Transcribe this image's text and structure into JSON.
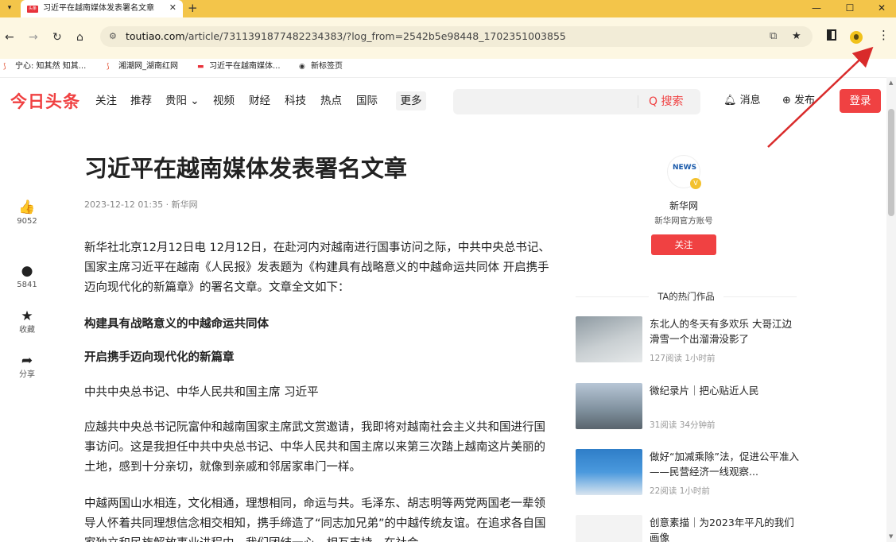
{
  "browser": {
    "tab_title": "习近平在越南媒体发表署名文章",
    "tab_favicon_text": "头条",
    "new_tab": "+",
    "minimize": "—",
    "maximize": "☐",
    "close": "✕",
    "tab_close": "✕",
    "url_host": "toutiao.com",
    "url_path": "/article/7311391877482234383/?log_from=2542b5e98448_1702351003855",
    "bookmarks": [
      {
        "label": "宁心: 知其然 知其..."
      },
      {
        "label": "湘潮网_湖南红网"
      },
      {
        "label": "习近平在越南媒体..."
      },
      {
        "label": "新标签页"
      }
    ]
  },
  "site": {
    "logo": "今日头条",
    "nav": [
      "关注",
      "推荐",
      "贵阳 ⌄",
      "视频",
      "财经",
      "科技",
      "热点",
      "国际"
    ],
    "nav_more": "更多",
    "search_placeholder": "",
    "search_label": "Q 搜索",
    "messages": "消息",
    "publish": "发布",
    "login": "登录"
  },
  "article": {
    "title": "习近平在越南媒体发表署名文章",
    "meta": "2023-12-12 01:35 · 新华网",
    "paragraphs": [
      "新华社北京12月12日电 12月12日，在赴河内对越南进行国事访问之际，中共中央总书记、国家主席习近平在越南《人民报》发表题为《构建具有战略意义的中越命运共同体 开启携手迈向现代化的新篇章》的署名文章。文章全文如下：",
      "构建具有战略意义的中越命运共同体",
      "开启携手迈向现代化的新篇章",
      "中共中央总书记、中华人民共和国主席 习近平",
      "应越共中央总书记阮富仲和越南国家主席武文赏邀请，我即将对越南社会主义共和国进行国事访问。这是我担任中共中央总书记、中华人民共和国主席以来第三次踏上越南这片美丽的土地，感到十分亲切，就像到亲戚和邻居家串门一样。",
      "中越两国山水相连，文化相通，理想相同，命运与共。毛泽东、胡志明等两党两国老一辈领导人怀着共同理想信念相交相知，携手缔造了“同志加兄弟”的中越传统友谊。在追求各自国家独立和民族解放事业进程中，我们团结一心、相互支持，在社会"
    ]
  },
  "actions": [
    {
      "icon": "👍",
      "label": "9052"
    },
    {
      "icon": "●",
      "label": "5841"
    },
    {
      "icon": "★",
      "label": "收藏"
    },
    {
      "icon": "➦",
      "label": "分享"
    }
  ],
  "author": {
    "logo_text": "NEWS",
    "badge": "V",
    "name": "新华网",
    "desc": "新华网官方账号",
    "follow": "关注"
  },
  "hot": {
    "title": "TA的热门作品",
    "items": [
      {
        "text": "东北人的冬天有多欢乐 大哥江边滑雪一个出溜滑没影了",
        "meta": "127阅读 1小时前"
      },
      {
        "text": "微纪录片｜把心贴近人民",
        "meta": "31阅读 34分钟前"
      },
      {
        "text": "做好“加减乘除”法，促进公平准入——民营经济一线观察...",
        "meta": "22阅读 1小时前"
      },
      {
        "text": "创意素描｜为2023年平凡的我们画像",
        "meta": ""
      }
    ]
  },
  "colors": {
    "brand_red": "#f04142",
    "tabbar_yellow": "#f3c54a",
    "arrow_red": "#d92b2b"
  }
}
